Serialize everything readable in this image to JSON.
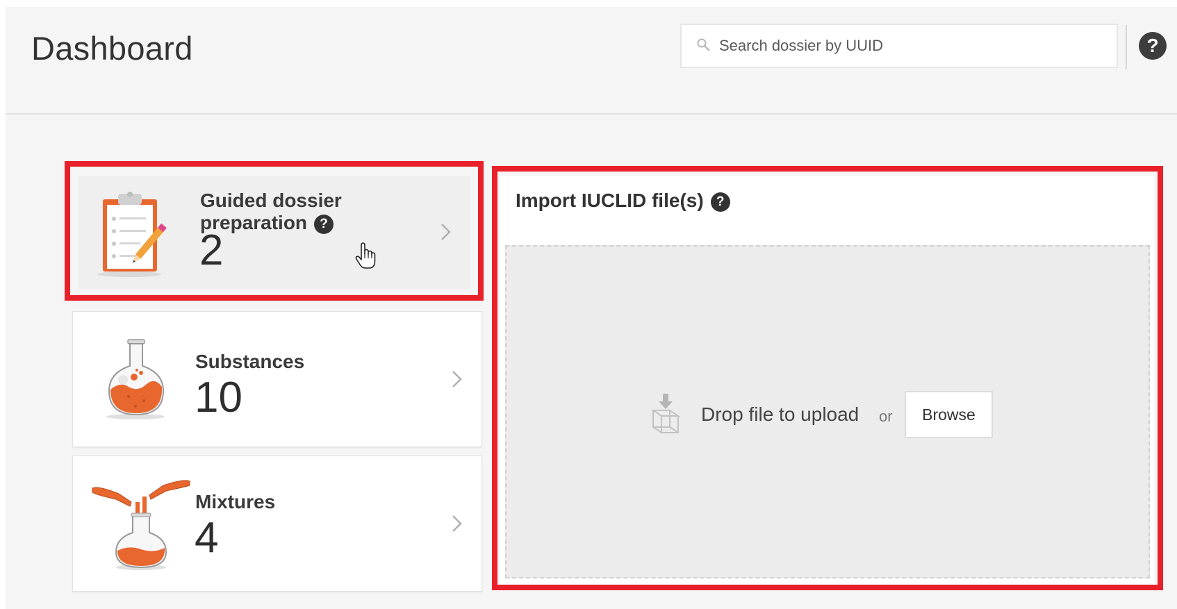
{
  "header": {
    "title": "Dashboard",
    "search": {
      "placeholder": "Search dossier by UUID",
      "value": ""
    },
    "help_icon": "question-circle-icon"
  },
  "cards": {
    "guided": {
      "label": "Guided dossier preparation",
      "count": "2",
      "icon": "clipboard-pencil-illustration",
      "help_icon": "question-circle-icon"
    },
    "substances": {
      "label": "Substances",
      "count": "10",
      "icon": "flask-illustration"
    },
    "mixtures": {
      "label": "Mixtures",
      "count": "4",
      "icon": "pouring-flasks-illustration"
    }
  },
  "import": {
    "title": "Import IUCLID file(s)",
    "drop_text": "Drop file to upload",
    "or_text": "or",
    "browse_label": "Browse",
    "drop_icon": "upload-box-icon"
  },
  "colors": {
    "accent_orange": "#e8672f",
    "highlight_red": "#e8202a",
    "background": "#f5f5f5"
  }
}
